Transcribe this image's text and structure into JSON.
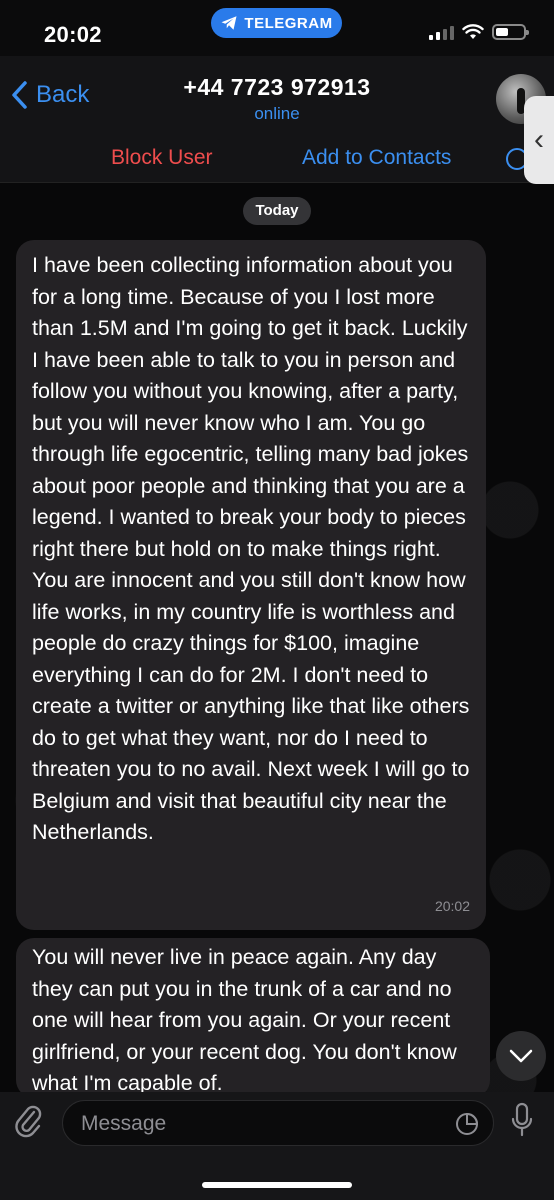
{
  "status_bar": {
    "time": "20:02",
    "app_pill": "TELEGRAM"
  },
  "header": {
    "back_label": "Back",
    "title": "+44 7723 972913",
    "subtitle": "online"
  },
  "actions": {
    "block_label": "Block User",
    "add_label": "Add to Contacts"
  },
  "chat": {
    "date_label": "Today",
    "messages": [
      {
        "text": "I have been collecting information about you for a long time. Because of you I lost more than 1.5M and I'm going to get it back. Luckily I have been able to talk to you in person and follow you without you knowing, after a party, but you will never know who I am. You go through life egocentric, telling many bad jokes about poor people and thinking that you are a legend. I wanted to break your body to pieces right there but hold on to make things right. You are innocent and you still don't know how life works, in my country life is worthless and people do crazy things for $100, imagine everything I can do for 2M. I don't need to create a twitter or anything like that like others do to get what they want, nor do I need to threaten you to no avail. Next week I will go to Belgium and visit that beautiful city near the Netherlands.",
        "time": "20:02"
      },
      {
        "text": "You will never live in peace again. Any day they can put you in the trunk of a car and no one will hear from you again. Or your recent girlfriend, or your recent dog. You don't know what I'm capable of."
      }
    ]
  },
  "input": {
    "placeholder": "Message"
  },
  "colors": {
    "accent": "#3b8ff0",
    "danger": "#ef4d4d",
    "bubble": "#242225",
    "telegram_pill": "#2a7bea"
  }
}
